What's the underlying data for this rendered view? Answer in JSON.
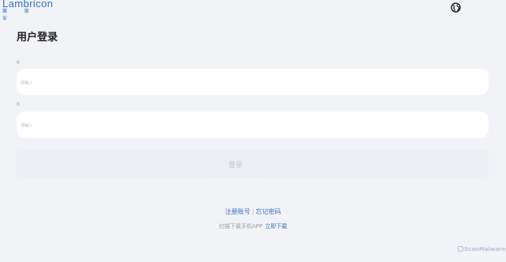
{
  "header": {
    "logo_text": "Lambricon",
    "logo_subtitle": "赛 斯 安",
    "language_icon": "globe-icon"
  },
  "login": {
    "title": "用户登录",
    "username_label": "账",
    "username_placeholder": "请输入",
    "password_label": "密",
    "password_placeholder": "请输入",
    "submit_label": "登录"
  },
  "links": {
    "register": "注册账号",
    "separator": "|",
    "forgot": "忘记密码"
  },
  "app": {
    "prompt": "扫描下载手机APP",
    "download": "立即下载"
  },
  "watermark": {
    "text": "ScanMalware"
  },
  "colors": {
    "background": "#f2f3f7",
    "accent": "#3c6ec8",
    "field": "#ffffff"
  }
}
